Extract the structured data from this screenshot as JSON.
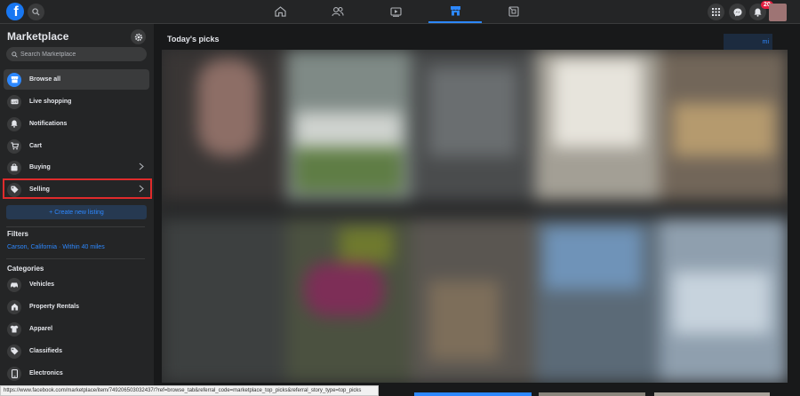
{
  "topbar": {
    "logo_letter": "f",
    "notification_count": "20",
    "tabs": [
      {
        "name": "home-icon",
        "active": false
      },
      {
        "name": "friends-icon",
        "active": false
      },
      {
        "name": "watch-icon",
        "active": false
      },
      {
        "name": "marketplace-icon",
        "active": true
      },
      {
        "name": "gaming-icon",
        "active": false
      }
    ]
  },
  "sidebar": {
    "title": "Marketplace",
    "search_placeholder": "Search Marketplace",
    "items": [
      {
        "label": "Browse all",
        "icon": "storefront-icon",
        "active": true
      },
      {
        "label": "Live shopping",
        "icon": "live-video-icon",
        "active": false
      },
      {
        "label": "Notifications",
        "icon": "bell-icon",
        "active": false
      },
      {
        "label": "Cart",
        "icon": "cart-icon",
        "active": false
      },
      {
        "label": "Buying",
        "icon": "shopping-bag-icon",
        "active": false,
        "chevron": true
      },
      {
        "label": "Selling",
        "icon": "tag-icon",
        "active": false,
        "chevron": true
      }
    ],
    "create_listing": "+ Create new listing",
    "filters_heading": "Filters",
    "filters_value": "Carson, California · Within 40 miles",
    "categories_heading": "Categories",
    "categories": [
      {
        "label": "Vehicles",
        "icon": "car-icon"
      },
      {
        "label": "Property Rentals",
        "icon": "house-icon"
      },
      {
        "label": "Apparel",
        "icon": "shirt-icon"
      },
      {
        "label": "Classifieds",
        "icon": "tag-icon"
      },
      {
        "label": "Electronics",
        "icon": "phone-icon"
      }
    ]
  },
  "main": {
    "title": "Today's picks",
    "location_chip": "mi"
  },
  "status_url": "https://www.facebook.com/marketplace/item/749206503032437/?ref=browse_tab&referral_code=marketplace_top_picks&referral_story_type=top_picks",
  "colors": {
    "accent": "#2d88ff",
    "highlight_box": "#e02b2b",
    "notification_badge": "#e41e3f"
  }
}
